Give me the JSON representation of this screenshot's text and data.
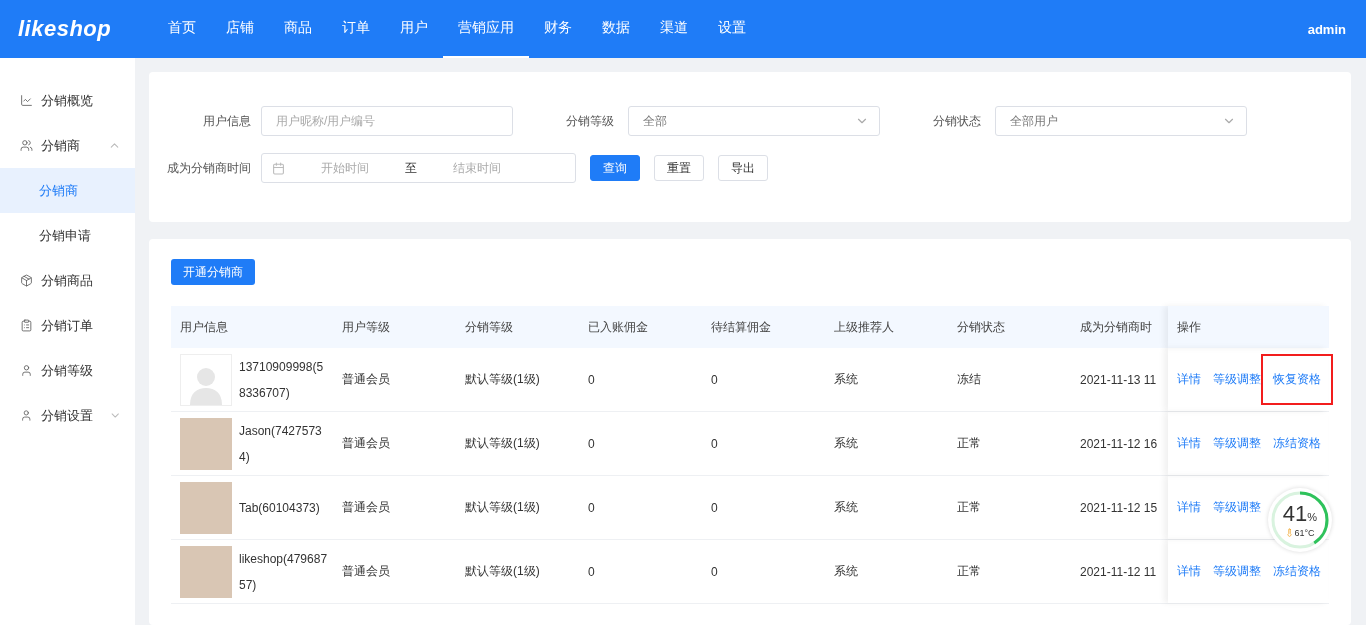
{
  "header": {
    "logo": "likeshop",
    "nav": [
      {
        "label": "首页",
        "selected": false
      },
      {
        "label": "店铺",
        "selected": false
      },
      {
        "label": "商品",
        "selected": false
      },
      {
        "label": "订单",
        "selected": false
      },
      {
        "label": "用户",
        "selected": false
      },
      {
        "label": "营销应用",
        "selected": true
      },
      {
        "label": "财务",
        "selected": false
      },
      {
        "label": "数据",
        "selected": false
      },
      {
        "label": "渠道",
        "selected": false
      },
      {
        "label": "设置",
        "selected": false
      }
    ],
    "user": "admin"
  },
  "sidebar": {
    "items": [
      {
        "label": "分销概览"
      },
      {
        "label": "分销商",
        "expanded": true,
        "children": [
          {
            "label": "分销商",
            "selected": true
          },
          {
            "label": "分销申请",
            "selected": false
          }
        ]
      },
      {
        "label": "分销商品"
      },
      {
        "label": "分销订单"
      },
      {
        "label": "分销等级"
      },
      {
        "label": "分销设置",
        "expanded": false
      }
    ]
  },
  "filters": {
    "user_info": {
      "label": "用户信息",
      "placeholder": "用户昵称/用户编号"
    },
    "level": {
      "label": "分销等级",
      "value": "全部"
    },
    "status": {
      "label": "分销状态",
      "value": "全部用户"
    },
    "time": {
      "label": "成为分销商时间",
      "start_placeholder": "开始时间",
      "separator": "至",
      "end_placeholder": "结束时间"
    },
    "buttons": [
      {
        "label": "查询",
        "kind": "primary"
      },
      {
        "label": "重置",
        "kind": "plain"
      },
      {
        "label": "导出",
        "kind": "plain"
      }
    ]
  },
  "table": {
    "add_button": "开通分销商",
    "columns": [
      "用户信息",
      "用户等级",
      "分销等级",
      "已入账佣金",
      "待结算佣金",
      "上级推荐人",
      "分销状态",
      "成为分销商时",
      "操作"
    ],
    "rows": [
      {
        "kind": "default",
        "user": "13710909998(58336707)",
        "user_level": "普通会员",
        "dist_level": "默认等级(1级)",
        "settled": "0",
        "pending": "0",
        "referrer": "系统",
        "status": "冻结",
        "time": "2021-11-13 11",
        "actions": [
          {
            "label": "详情",
            "highlighted": false
          },
          {
            "label": "等级调整",
            "highlighted": false
          },
          {
            "label": "恢复资格",
            "highlighted": true
          }
        ]
      },
      {
        "kind": "photo",
        "user": "Jason(74275734)",
        "user_level": "普通会员",
        "dist_level": "默认等级(1级)",
        "settled": "0",
        "pending": "0",
        "referrer": "系统",
        "status": "正常",
        "time": "2021-11-12 16",
        "actions": [
          {
            "label": "详情",
            "highlighted": false
          },
          {
            "label": "等级调整",
            "highlighted": false
          },
          {
            "label": "冻结资格",
            "highlighted": false
          }
        ]
      },
      {
        "kind": "photo",
        "user": "Tab(60104373)",
        "user_level": "普通会员",
        "dist_level": "默认等级(1级)",
        "settled": "0",
        "pending": "0",
        "referrer": "系统",
        "status": "正常",
        "time": "2021-11-12 15",
        "actions": [
          {
            "label": "详情",
            "highlighted": false
          },
          {
            "label": "等级调整",
            "highlighted": false
          }
        ]
      },
      {
        "kind": "photo",
        "user": "likeshop(47968757)",
        "user_level": "普通会员",
        "dist_level": "默认等级(1级)",
        "settled": "0",
        "pending": "0",
        "referrer": "系统",
        "status": "正常",
        "time": "2021-11-12 11",
        "actions": [
          {
            "label": "详情",
            "highlighted": false
          },
          {
            "label": "等级调整",
            "highlighted": false
          },
          {
            "label": "冻结资格",
            "highlighted": false
          }
        ]
      }
    ]
  },
  "monitor": {
    "value": "41",
    "unit": "%",
    "temperature": "61°C",
    "level": 0.41
  }
}
